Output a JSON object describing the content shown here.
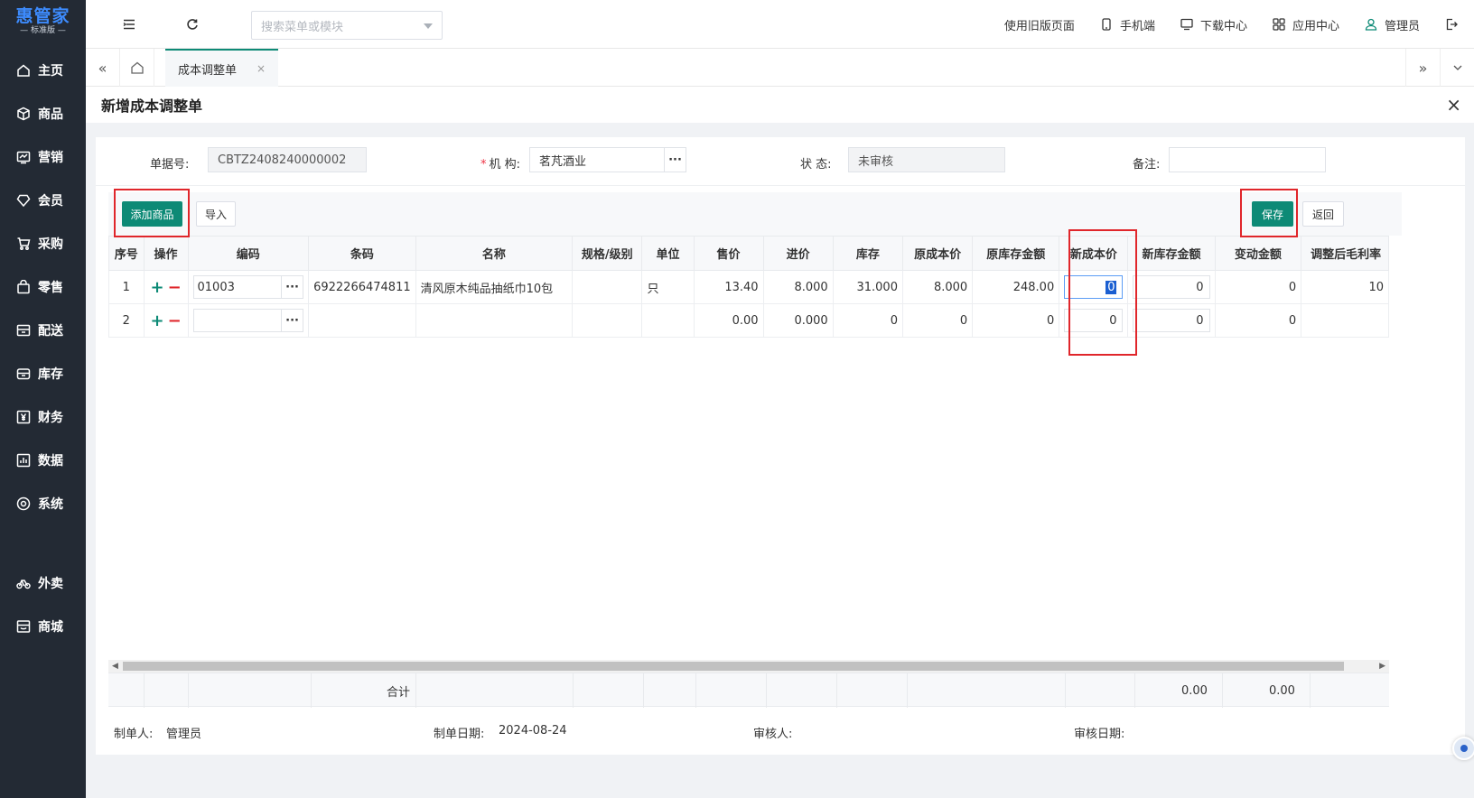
{
  "app": {
    "brand": "惠管家",
    "edition": "— 标准版 —"
  },
  "sidebar": {
    "items": [
      {
        "label": "主页",
        "icon": "home-icon"
      },
      {
        "label": "商品",
        "icon": "box-icon"
      },
      {
        "label": "营销",
        "icon": "chart-icon"
      },
      {
        "label": "会员",
        "icon": "diamond-icon"
      },
      {
        "label": "采购",
        "icon": "cart-icon"
      },
      {
        "label": "零售",
        "icon": "bag-icon"
      },
      {
        "label": "配送",
        "icon": "truck-icon"
      },
      {
        "label": "库存",
        "icon": "storage-icon"
      },
      {
        "label": "财务",
        "icon": "yen-icon"
      },
      {
        "label": "数据",
        "icon": "bar-chart-icon"
      },
      {
        "label": "系统",
        "icon": "settings-icon"
      }
    ],
    "extra_items": [
      {
        "label": "外卖",
        "icon": "bike-icon"
      },
      {
        "label": "商城",
        "icon": "shop-icon"
      }
    ]
  },
  "topbar": {
    "search_placeholder": "搜索菜单或模块",
    "links": {
      "old_page": "使用旧版页面",
      "mobile": "手机端",
      "download": "下载中心",
      "apps": "应用中心",
      "user": "管理员"
    }
  },
  "tabs": {
    "active": "成本调整单",
    "close": "×"
  },
  "page": {
    "title": "新增成本调整单",
    "close": "×"
  },
  "form": {
    "doc_no_label": "单据号:",
    "doc_no": "CBTZ2408240000002",
    "org_required": "*",
    "org_label": "机 构:",
    "org": "茗芃酒业",
    "status_label": "状 态:",
    "status": "未审核",
    "remark_label": "备注:",
    "remark": ""
  },
  "toolbar": {
    "add_label": "添加商品",
    "import_label": "导入",
    "save_label": "保存",
    "back_label": "返回"
  },
  "grid": {
    "headers": {
      "seq": "序号",
      "op": "操作",
      "code": "编码",
      "barcode": "条码",
      "name": "名称",
      "spec": "规格/级别",
      "unit": "单位",
      "price": "售价",
      "cost_in": "进价",
      "stock": "库存",
      "orig_cost": "原成本价",
      "orig_amount": "原库存金额",
      "new_cost": "新成本价",
      "new_amount": "新库存金额",
      "change_amount": "变动金额",
      "margin": "调整后毛利率"
    },
    "rows": [
      {
        "seq": "1",
        "code": "01003",
        "barcode": "6922266474811",
        "name": "清风原木纯品抽纸巾10包",
        "spec": "",
        "unit": "只",
        "price": "13.40",
        "cost_in": "8.000",
        "stock": "31.000",
        "orig_cost": "8.000",
        "orig_amount": "248.00",
        "new_cost": "0",
        "new_amount": "0",
        "change_amount": "0",
        "margin": "10"
      },
      {
        "seq": "2",
        "code": "",
        "barcode": "",
        "name": "",
        "spec": "",
        "unit": "",
        "price": "0.00",
        "cost_in": "0.000",
        "stock": "0",
        "orig_cost": "0",
        "orig_amount": "0",
        "new_cost": "0",
        "new_amount": "0",
        "change_amount": "0",
        "margin": ""
      }
    ],
    "summary": {
      "label": "合计",
      "new_amount": "0.00",
      "change_amount": "0.00"
    }
  },
  "footer": {
    "creator_label": "制单人:",
    "creator": "管理员",
    "date_label": "制单日期:",
    "date": "2024-08-24",
    "auditor_label": "审核人:",
    "auditor": "",
    "audit_date_label": "审核日期:",
    "audit_date": ""
  },
  "colors": {
    "sidebar": "#232a34",
    "primary": "#0d8a76",
    "highlight": "#e0262b"
  }
}
